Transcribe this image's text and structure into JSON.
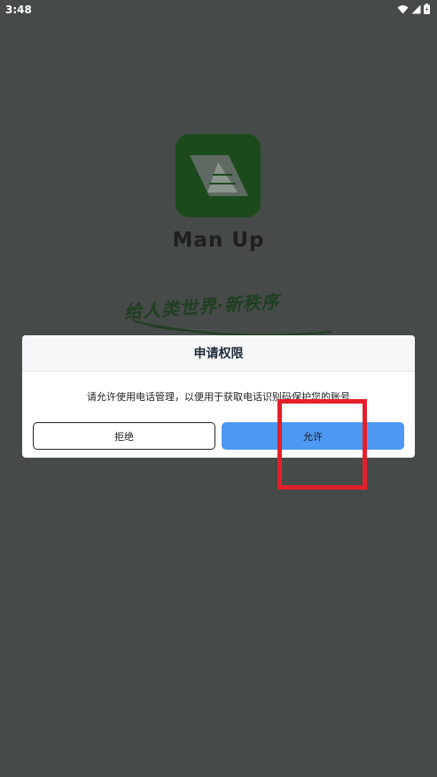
{
  "status_bar": {
    "time": "3:48",
    "icons": [
      "wifi-icon",
      "cellular-signal-icon",
      "battery-icon"
    ]
  },
  "splash": {
    "app_name": "Man Up",
    "slogan": "给人类世界·新秩序",
    "logo_icon": "manup-logo-icon"
  },
  "dialog": {
    "title": "申请权限",
    "message": "请允许使用电话管理，以便用于获取电话识别码保护您的账号",
    "deny_label": "拒绝",
    "allow_label": "允许"
  },
  "colors": {
    "overlay": "#464a48",
    "logo_bg": "#1b4b1c",
    "allow_button": "#4d98f1",
    "highlight": "#e3202a"
  }
}
